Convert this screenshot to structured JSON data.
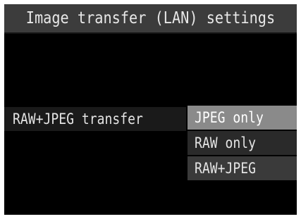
{
  "screen": {
    "title": "Image transfer (LAN) settings"
  },
  "setting": {
    "label": "RAW+JPEG transfer",
    "options": [
      {
        "label": "JPEG only",
        "selected": true
      },
      {
        "label": "RAW only",
        "selected": false
      },
      {
        "label": "RAW+JPEG",
        "selected": false
      }
    ]
  },
  "colors": {
    "background": "#000000",
    "title_bar": "#3c3c3c",
    "highlight": "#8a8a8a",
    "text": "#e4e4e4"
  }
}
